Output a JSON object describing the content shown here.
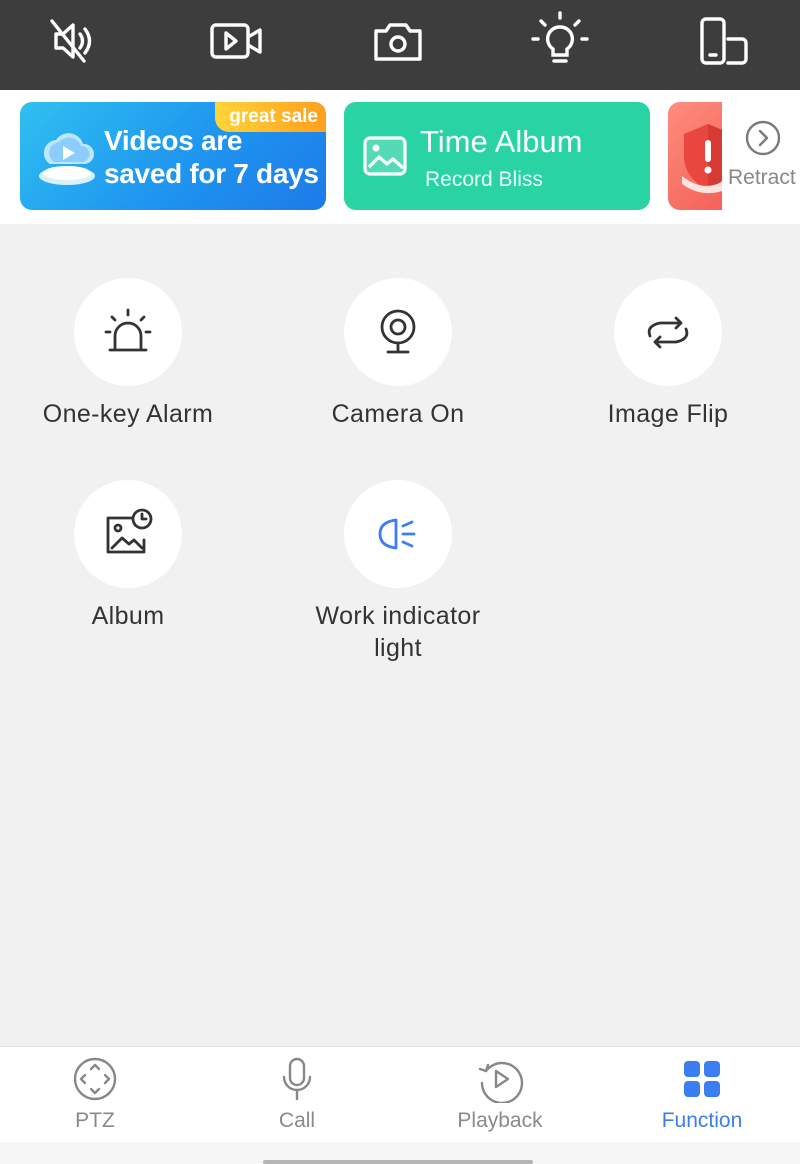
{
  "toolbar": {
    "items": [
      {
        "name": "mute",
        "icon": "speaker-muted-icon"
      },
      {
        "name": "record",
        "icon": "video-record-icon"
      },
      {
        "name": "snapshot",
        "icon": "camera-icon"
      },
      {
        "name": "light",
        "icon": "lightbulb-icon"
      },
      {
        "name": "screen",
        "icon": "phone-rotate-icon"
      }
    ],
    "background": "#3d3d3d"
  },
  "banners": {
    "cloud": {
      "title": "Videos are\nsaved for 7 days",
      "tag": "great sale",
      "icon": "cloud-video-icon"
    },
    "album": {
      "title": "Time Album",
      "subtitle": "Record Bliss",
      "icon": "image-icon"
    },
    "security": {
      "icon": "shield-alert-icon"
    },
    "retract": {
      "label": "Retract",
      "icon": "chevron-right-circle-icon"
    }
  },
  "functions": [
    {
      "label": "One-key Alarm",
      "icon": "siren-icon"
    },
    {
      "label": "Camera On",
      "icon": "webcam-icon"
    },
    {
      "label": "Image Flip",
      "icon": "flip-rotate-icon"
    },
    {
      "label": "Album",
      "icon": "album-clock-icon"
    },
    {
      "label": "Work indicator light",
      "icon": "headlight-icon"
    }
  ],
  "tabs": [
    {
      "label": "PTZ",
      "icon": "ptz-direction-icon",
      "active": false
    },
    {
      "label": "Call",
      "icon": "microphone-icon",
      "active": false
    },
    {
      "label": "Playback",
      "icon": "playback-icon",
      "active": false
    },
    {
      "label": "Function",
      "icon": "grid-icon",
      "active": true
    }
  ],
  "colors": {
    "accent": "#3a7ef0",
    "cloud_banner": "#1f95f0",
    "album_banner": "#2ad3a4",
    "sale_tag": "#ff9f1c"
  }
}
